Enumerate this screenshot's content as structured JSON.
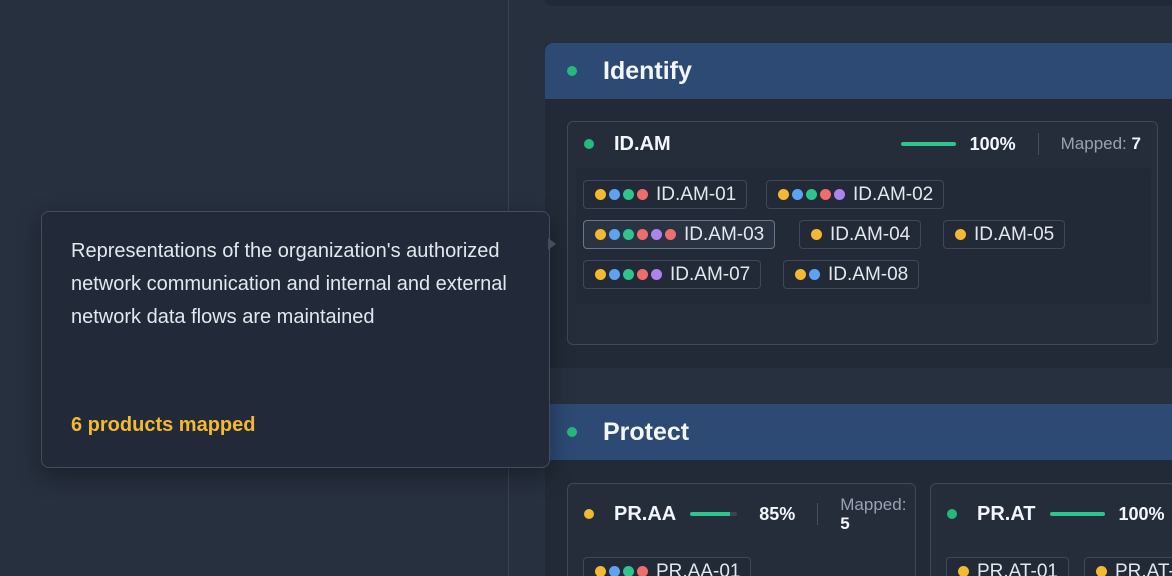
{
  "identify": {
    "title": "Identify",
    "card": {
      "code": "ID.AM",
      "percent": "100%",
      "progress": 1.0,
      "mapped_label": "Mapped:",
      "mapped_value": "7",
      "chips": [
        {
          "label": "ID.AM-01",
          "dots": [
            "yellow",
            "blue",
            "green",
            "red"
          ]
        },
        {
          "label": "ID.AM-02",
          "dots": [
            "yellow",
            "blue",
            "green",
            "red",
            "purple"
          ]
        },
        {
          "label": "ID.AM-03",
          "dots": [
            "yellow",
            "blue",
            "green",
            "red",
            "purple",
            "red"
          ]
        },
        {
          "label": "ID.AM-04",
          "dots": [
            "yellow"
          ]
        },
        {
          "label": "ID.AM-05",
          "dots": [
            "yellow"
          ]
        },
        {
          "label": "ID.AM-07",
          "dots": [
            "yellow",
            "blue",
            "green",
            "red",
            "purple"
          ]
        },
        {
          "label": "ID.AM-08",
          "dots": [
            "yellow",
            "blue"
          ]
        }
      ]
    }
  },
  "protect": {
    "title": "Protect",
    "cards": [
      {
        "code": "PR.AA",
        "percent": "85%",
        "progress": 0.85,
        "mapped_label": "Mapped:",
        "mapped_value": "5",
        "chips": [
          {
            "label": "PR.AA-01",
            "dots": [
              "yellow",
              "blue",
              "green",
              "red"
            ]
          }
        ]
      },
      {
        "code": "PR.AT",
        "percent": "100%",
        "progress": 1.0,
        "chips": [
          {
            "label": "PR.AT-01",
            "dots": [
              "yellow"
            ]
          },
          {
            "label": "PR.AT-",
            "dots": [
              "yellow"
            ]
          }
        ]
      }
    ]
  },
  "tooltip": {
    "text": "Representations of the organization's authorized network communication and internal and external network data flows are maintained",
    "count": "6 products mapped"
  },
  "colors": {
    "accent_green": "#2fc38e",
    "warning_yellow": "#f4b930",
    "header_blue": "#2c4a74"
  }
}
